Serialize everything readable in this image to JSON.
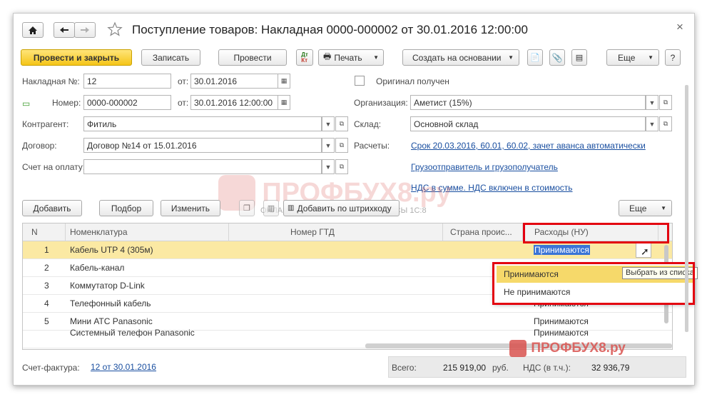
{
  "window": {
    "title": "Поступление товаров: Накладная 0000-000002 от 30.01.2016 12:00:00",
    "close_glyph": "×"
  },
  "toolbar": {
    "post_close": "Провести и закрыть",
    "write": "Записать",
    "post": "Провести",
    "print": "Печать",
    "create_based": "Создать на основании",
    "more": "Еще",
    "help": "?"
  },
  "header": {
    "invoice_label": "Накладная №:",
    "invoice_value": "12",
    "from_label1": "от:",
    "invoice_date": "30.01.2016",
    "original_label": "Оригинал получен",
    "number_label": "Номер:",
    "number_value": "0000-000002",
    "from_label2": "от:",
    "number_date": "30.01.2016 12:00:00",
    "org_label": "Организация:",
    "org_value": "Аметист (15%)",
    "counterparty_label": "Контрагент:",
    "counterparty_value": "Фитиль",
    "warehouse_label": "Склад:",
    "warehouse_value": "Основной склад",
    "contract_label": "Договор:",
    "contract_value": "Договор №14 от 15.01.2016",
    "settlements_label": "Расчеты:",
    "settlements_link": "Срок 20.03.2016, 60.01, 60.02, зачет аванса автоматически",
    "bill_label": "Счет на оплату:",
    "bill_value": "",
    "shipper_link": "Грузоотправитель и грузополучатель",
    "vat_link": "НДС в сумме. НДС включен в стоимость"
  },
  "table_toolbar": {
    "add": "Добавить",
    "pick": "Подбор",
    "edit": "Изменить",
    "barcode": "Добавить по штрихкоду",
    "more": "Еще"
  },
  "table": {
    "columns": [
      "N",
      "Номенклатура",
      "Номер ГТД",
      "Страна проис...",
      "Расходы (НУ)"
    ],
    "rows": [
      {
        "n": "1",
        "name": "Кабель UTP 4 (305м)",
        "expense": "Принимаются"
      },
      {
        "n": "2",
        "name": "Кабель-канал",
        "expense": ""
      },
      {
        "n": "3",
        "name": "Коммутатор D-Link",
        "expense": ""
      },
      {
        "n": "4",
        "name": "Телефонный кабель",
        "expense": "Принимаются"
      },
      {
        "n": "5",
        "name": "Мини АТС Panasonic",
        "expense": "Принимаются"
      },
      {
        "n": "",
        "name": "Системный телефон Panasonic",
        "expense": "Принимаются"
      }
    ]
  },
  "dropdown": {
    "options": [
      "Принимаются",
      "Не принимаются"
    ],
    "tooltip": "Выбрать из списка"
  },
  "footer": {
    "invoice_label": "Счет-фактура:",
    "invoice_link": "12 от 30.01.2016",
    "total_label": "Всего:",
    "total_value": "215 919,00",
    "currency": "руб.",
    "vat_label": "НДС (в т.ч.):",
    "vat_value": "32 936,79"
  },
  "watermark": {
    "brand": "ПРОФБУХ8.ру",
    "tagline": "ОНЛАЙН-СЕМИНАРЫ И ВИДЕОКУРСЫ 1С:8"
  },
  "colors": {
    "accent_yellow": "#f5c518",
    "highlight_red": "#e3000f",
    "link_blue": "#1a4fa0",
    "selection_row": "#fbe9a3"
  }
}
